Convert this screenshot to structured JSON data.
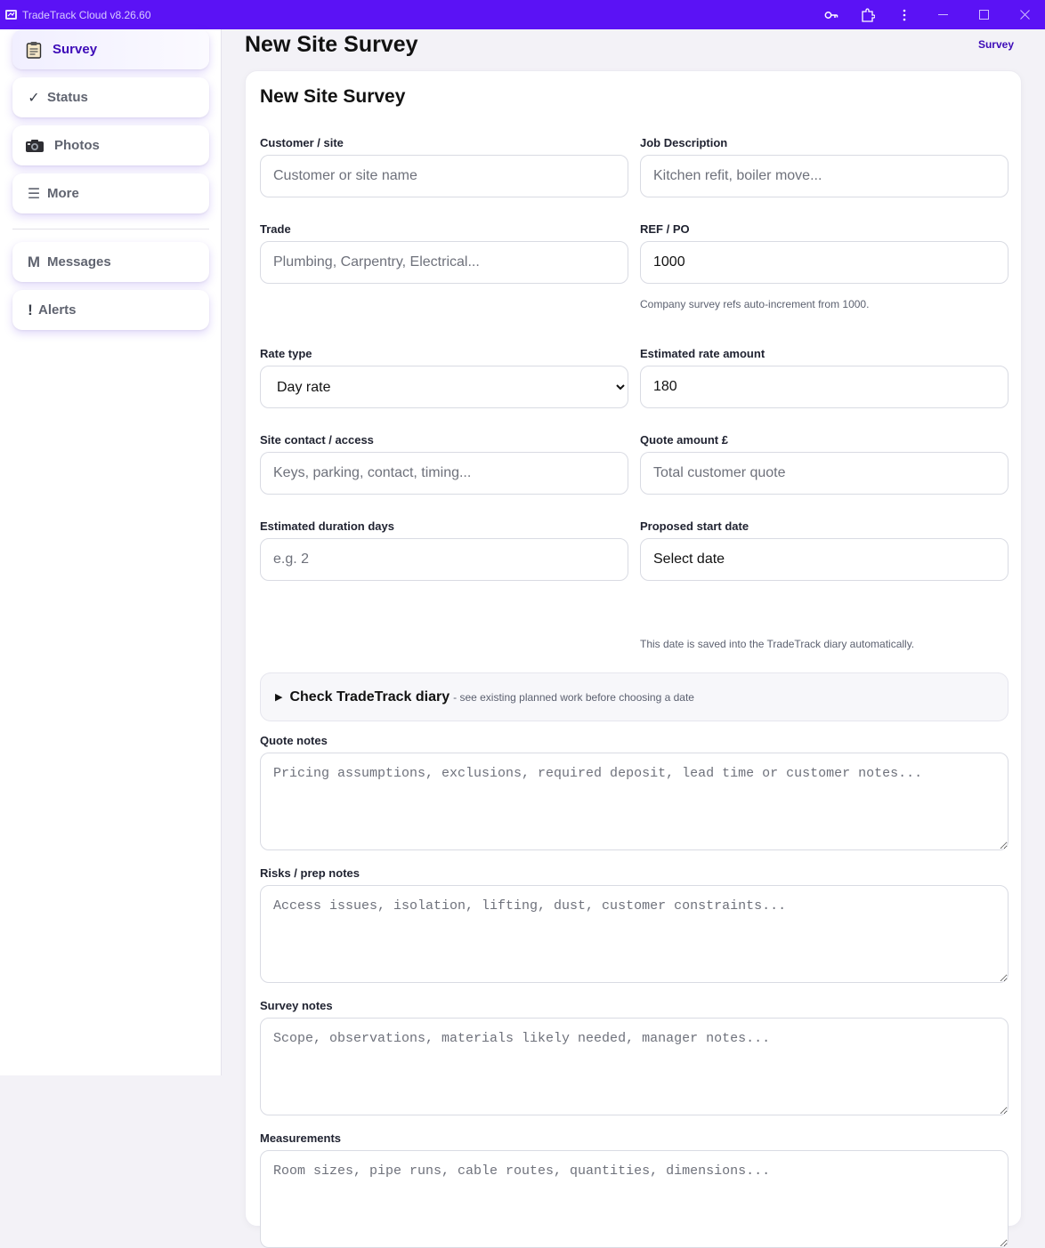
{
  "window": {
    "title": "TradeTrack Cloud v8.26.60"
  },
  "sidebar": {
    "items": [
      {
        "label": "Survey",
        "icon": "clipboard-icon"
      },
      {
        "label": "Status",
        "icon": "checkmark-icon",
        "glyph": "✓"
      },
      {
        "label": "Photos",
        "icon": "camera-icon"
      },
      {
        "label": "More",
        "icon": "menu-icon",
        "glyph": "☰"
      },
      {
        "label": "Messages",
        "icon": "messages-icon",
        "glyph": "M"
      },
      {
        "label": "Alerts",
        "icon": "alert-icon",
        "glyph": "!"
      }
    ]
  },
  "header": {
    "title": "New Site Survey",
    "crumb": "Survey"
  },
  "form": {
    "title": "New Site Survey",
    "customer": {
      "label": "Customer / site",
      "placeholder": "Customer or site name"
    },
    "job": {
      "label": "Job Description",
      "placeholder": "Kitchen refit, boiler move..."
    },
    "trade": {
      "label": "Trade",
      "placeholder": "Plumbing, Carpentry, Electrical..."
    },
    "ref": {
      "label": "REF / PO",
      "value": "1000",
      "hint": "Company survey refs auto-increment from 1000."
    },
    "rate_type": {
      "label": "Rate type",
      "value": "Day rate"
    },
    "rate_amount": {
      "label": "Estimated rate amount",
      "value": "180"
    },
    "site_contact": {
      "label": "Site contact / access",
      "placeholder": "Keys, parking, contact, timing..."
    },
    "quote_amount": {
      "label": "Quote amount £",
      "placeholder": "Total customer quote"
    },
    "duration": {
      "label": "Estimated duration days",
      "placeholder": "e.g. 2"
    },
    "start_date": {
      "label": "Proposed start date",
      "value": "Select date",
      "hint": "This date is saved into the TradeTrack diary automatically."
    },
    "diary": {
      "title": "Check TradeTrack diary",
      "subtitle": "- see existing planned work before choosing a date"
    },
    "quote_notes": {
      "label": "Quote notes",
      "placeholder": "Pricing assumptions, exclusions, required deposit, lead time or customer notes..."
    },
    "risks": {
      "label": "Risks / prep notes",
      "placeholder": "Access issues, isolation, lifting, dust, customer constraints..."
    },
    "survey_notes": {
      "label": "Survey notes",
      "placeholder": "Scope, observations, materials likely needed, manager notes..."
    },
    "measurements": {
      "label": "Measurements",
      "placeholder": "Room sizes, pipe runs, cable routes, quantities, dimensions..."
    }
  },
  "colors": {
    "accent": "#5b12f5",
    "active_text": "#3d0bb8"
  }
}
